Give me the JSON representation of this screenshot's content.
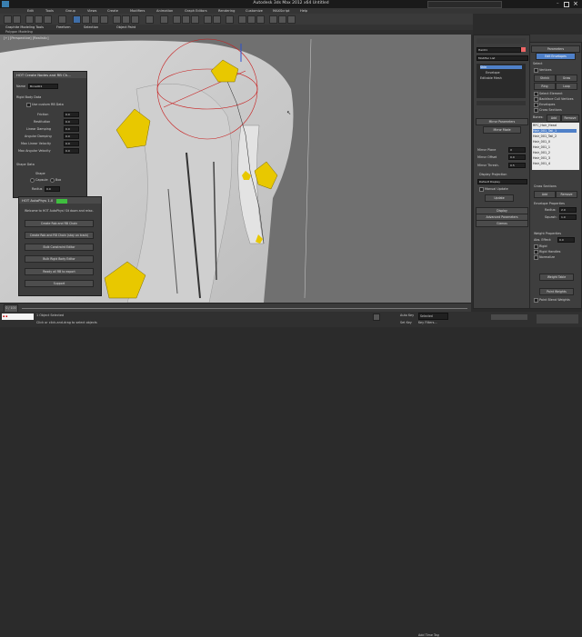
{
  "window": {
    "title": "Autodesk 3ds Max 2012 x64    Untitled",
    "search_placeholder": "Type a keyword or phrase"
  },
  "menubar": {
    "items": [
      "Edit",
      "Tools",
      "Group",
      "Views",
      "Create",
      "Modifiers",
      "Animation",
      "Graph Editors",
      "Rendering",
      "Customize",
      "MAXScript",
      "Help"
    ]
  },
  "ribbon": {
    "tabs": [
      "Graphite Modeling Tools",
      "Freeform",
      "Selection",
      "Object Paint"
    ],
    "sub": "Polygon Modeling"
  },
  "viewport": {
    "label": "[+] [Perspective] [Realistic]"
  },
  "create_dialog": {
    "title": "HOT Create Nodes and RB Ch...",
    "name_label": "Name",
    "name_value": "Bone001",
    "rigid_title": "Rigid Body Data",
    "use_custom": "Use custom RB Data",
    "rows": [
      {
        "label": "Friction",
        "value": "0.0"
      },
      {
        "label": "Restitution",
        "value": "0.0"
      },
      {
        "label": "Linear Damping",
        "value": "0.0"
      },
      {
        "label": "Angular Damping",
        "value": "0.0"
      },
      {
        "label": "Max Linear Velocity",
        "value": "0.0"
      },
      {
        "label": "Max Angular Velocity",
        "value": "0.0"
      }
    ],
    "shape_title": "Shape Data",
    "shape_label": "Shape",
    "capsule": "Capsule",
    "box": "Box",
    "radius_label": "Radius",
    "radius_value": "0.0"
  },
  "autophys_dialog": {
    "title": "HOT AutoPhys 1.0",
    "welcome": "Welcome to HOT AutoPhys! Sit down and relax.",
    "buttons": [
      "Create Rob and RB Chain",
      "Create Rob and RB Chain (stay on track)",
      "Bulk Constraint Editor",
      "Bulk Rigid Body Editor",
      "Ready all RB to export",
      "Support"
    ]
  },
  "modifier_panel": {
    "object_name": "Hair01",
    "modifier_list": "Modifier List",
    "stack": [
      "Skin",
      "Envelope",
      "Editable Mesh"
    ],
    "mirror_title": "Mirror Parameters",
    "mirror_mode": "Mirror Mode",
    "mirror_rows": [
      {
        "label": "Mirror Plane",
        "value": "X"
      },
      {
        "label": "Mirror Offset",
        "value": "0.0"
      },
      {
        "label": "Mirror Thresh.",
        "value": "0.5"
      }
    ],
    "display_proj": "Display Projection",
    "default_display": "Default Display",
    "manual_update": "Manual Update",
    "update": "Update",
    "rollouts": [
      "Display",
      "Advanced Parameters",
      "Gizmos"
    ]
  },
  "params_panel": {
    "title": "Parameters",
    "edit_envelopes": "Edit Envelopes",
    "select_label": "Select",
    "select_opts": [
      "Vertices",
      "Shrink",
      "Grow",
      "Ring",
      "Loop",
      "Select Element",
      "Backface Cull Vertices",
      "Envelopes",
      "Cross Sections"
    ],
    "bones_label": "Bones:",
    "add": "Add",
    "remove": "Remove",
    "bones": [
      "RFC_Hair_Head",
      "Hair_001_Tail_1",
      "Hair_001_Tail_2",
      "Hair_001_0",
      "Hair_001_1",
      "Hair_001_2",
      "Hair_001_3",
      "Hair_001_4"
    ],
    "cross_sections": "Cross Sections",
    "env_props": "Envelope Properties",
    "radius_label": "Radius:",
    "radius_value": "2.0",
    "squash_label": "Squash:",
    "squash_value": "1.0",
    "weight_props": "Weight Properties",
    "abs_effect": "Abs. Effect:",
    "abs_value": "0.0",
    "rigid": "Rigid",
    "rigid_handles": "Rigid Handles",
    "normalize": "Normalize",
    "weight_table": "Weight Table",
    "paint_weights": "Paint Weights",
    "paint_blend": "Paint Blend Weights"
  },
  "timeline": {
    "position": "0 / 100"
  },
  "status": {
    "selection": "1 Object Selected",
    "prompt": "Click or click-and-drag to select objects",
    "selected": "Selected",
    "auto_key": "Auto Key",
    "set_key": "Set Key",
    "key_filters": "Key Filters...",
    "add_time_tag": "Add Time Tag"
  },
  "colors": {
    "accent": "#4f80c8",
    "viewport_bg": "#6e6e6e",
    "bone_yellow": "#e8c800",
    "gizmo_red": "#c81e1e"
  }
}
